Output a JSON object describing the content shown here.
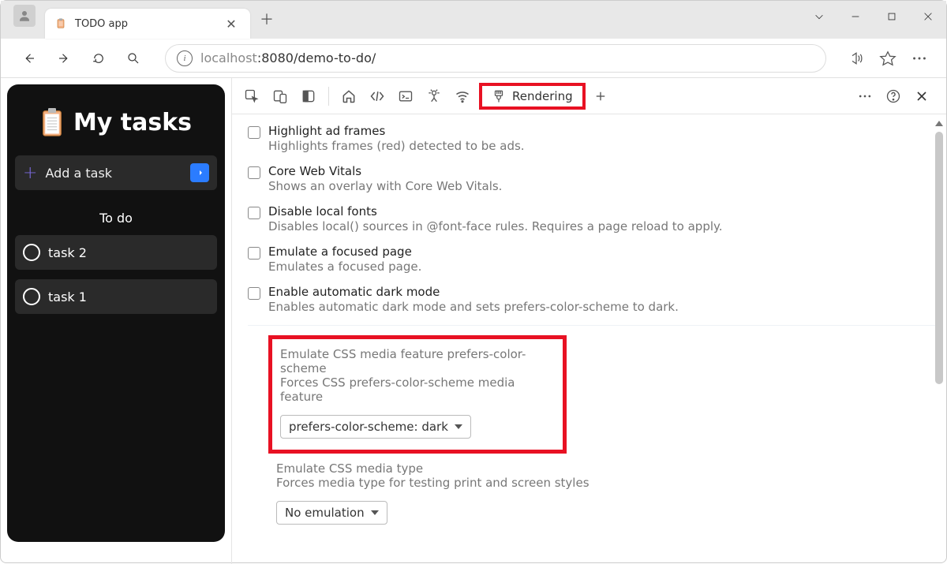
{
  "tab": {
    "title": "TODO app"
  },
  "address": {
    "host": "localhost",
    "port_path": ":8080/demo-to-do/"
  },
  "app": {
    "title": "My tasks",
    "add_placeholder": "Add a task",
    "section": "To do",
    "tasks": [
      "task 2",
      "task 1"
    ]
  },
  "devtools": {
    "rendering_tab": "Rendering",
    "options": [
      {
        "title": "Highlight ad frames",
        "desc": "Highlights frames (red) detected to be ads."
      },
      {
        "title": "Core Web Vitals",
        "desc": "Shows an overlay with Core Web Vitals."
      },
      {
        "title": "Disable local fonts",
        "desc": "Disables local() sources in @font-face rules. Requires a page reload to apply."
      },
      {
        "title": "Emulate a focused page",
        "desc": "Emulates a focused page."
      },
      {
        "title": "Enable automatic dark mode",
        "desc": "Enables automatic dark mode and sets prefers-color-scheme to dark."
      }
    ],
    "emulate_color": {
      "title": "Emulate CSS media feature prefers-color-scheme",
      "desc": "Forces CSS prefers-color-scheme media feature",
      "value": "prefers-color-scheme: dark"
    },
    "emulate_media": {
      "title": "Emulate CSS media type",
      "desc": "Forces media type for testing print and screen styles",
      "value": "No emulation"
    }
  }
}
